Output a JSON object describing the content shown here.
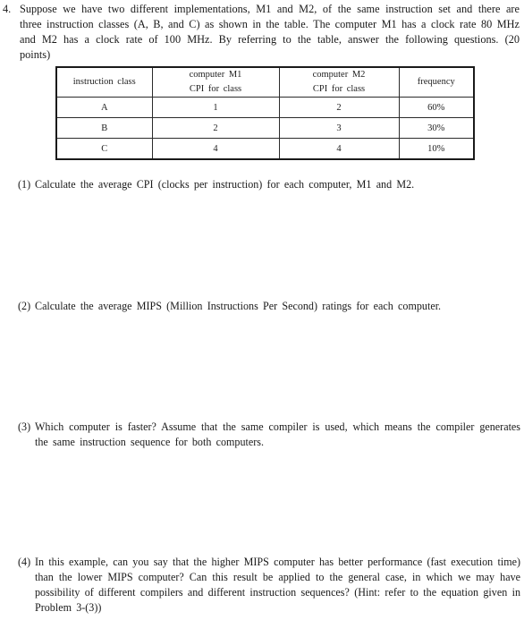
{
  "problem": {
    "number": "4.",
    "text": "Suppose we have two different implementations, M1 and M2, of the same instruction set and there are three instruction classes (A, B, and C) as shown in the table. The computer M1 has a clock rate 80 MHz and M2 has a clock rate of 100 MHz. By referring to the table, answer the following questions. (20 points)"
  },
  "table": {
    "headers": [
      [
        "instruction class"
      ],
      [
        "computer M1",
        "CPI for class"
      ],
      [
        "computer M2",
        "CPI for class"
      ],
      [
        "frequency"
      ]
    ],
    "rows": [
      [
        "A",
        "1",
        "2",
        "60%"
      ],
      [
        "B",
        "2",
        "3",
        "30%"
      ],
      [
        "C",
        "4",
        "4",
        "10%"
      ]
    ]
  },
  "questions": [
    {
      "number": "(1)",
      "text": "Calculate the average CPI (clocks per instruction) for each computer, M1 and M2."
    },
    {
      "number": "(2)",
      "text": "Calculate the average MIPS (Million Instructions Per Second) ratings for each computer."
    },
    {
      "number": "(3)",
      "text": "Which computer is faster? Assume that the same compiler is used, which means the compiler generates the same instruction sequence for both computers."
    },
    {
      "number": "(4)",
      "text": "In this example, can you say that the higher MIPS computer has better performance (fast execution time) than the lower MIPS computer? Can this result be applied to the general case, in which we may have possibility of different compilers and different instruction sequences? (Hint: refer to the equation given in Problem 3-(3))"
    }
  ]
}
